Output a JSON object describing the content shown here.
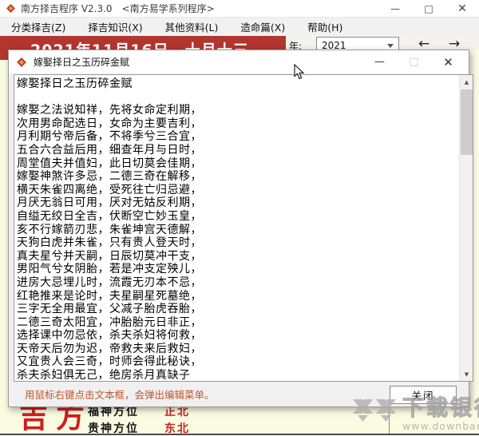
{
  "main_window": {
    "title": "南方择吉程序 V2.3.0　<南方易学系列程序>",
    "controls": {
      "minimize": "—",
      "maximize": "□",
      "close": "✕"
    },
    "menu": [
      "分类择吉(Z)",
      "择吉知识(X)",
      "其他资料(L)",
      "造命篇(X)",
      "帮助(H)"
    ],
    "date_banner": "2021年11月16日　十月十三",
    "year_label": "年:",
    "year_value": "2021",
    "nav_left": "←",
    "nav_right": "→",
    "bottom": {
      "big_label": "吉方",
      "rows": [
        {
          "label": "福神方位",
          "value": "正北"
        },
        {
          "label": "贵神方位",
          "value": "东北"
        }
      ]
    }
  },
  "dialog": {
    "title": "嫁娶择日之玉历碎金赋",
    "controls": {
      "minimize": "—",
      "maximize": "□",
      "close": "✕"
    },
    "text": "嫁娶择日之玉历碎金赋\n\n嫁娶之法说知祥，先将女命定利期，\n次用男命配选日，女命为主要吉利，\n月利期兮帝后备，不将季兮三合宜，\n五合六合益后用，细查年月与日时，\n周堂值夫并值妇，此日切莫会佳期，\n嫁娶神煞许多忌，二德三奇在解移，\n横天朱雀四离绝，受死往亡归忌避，\n月厌无翁日可用，厌对无姑反利期，\n自缢无绞日全吉，伏断空亡妙玉皇，\n亥不行嫁箭刃悲，朱雀坤宫天德解，\n天狗白虎并朱雀，只有贵人登天时，\n真夫星兮并天嗣，日辰切莫冲干支，\n男阳气兮女阴胎，若是冲支定殃儿，\n进房大忌埋儿时，流霞无刃本不忌，\n红艳推来是论时，夫星嗣星死墓绝，\n三字无全用最宜，父减子胎虎吞胎，\n二德三奇太阳宜，冲胎胎元日非正，\n选择课中勿忌依，杀夫杀妇将何救，\n天帝天后勿为迟，帝救夫来后救妇，\n又宜贵人会三奇，时师会得此秘诀，\n杀夫杀妇俱无己，绝房杀月真缺子",
    "hint": "用鼠标右键点击文本框，会弹出编辑菜单。",
    "close_button": "关闭"
  },
  "watermark": {
    "name": "下载银行",
    "url": "www.downbank.cn"
  },
  "colors": {
    "banner_red": "#b23530",
    "accent_red": "#cc2222",
    "hint_orange": "#c0562a",
    "pale_yellow": "#fbfbe2"
  }
}
